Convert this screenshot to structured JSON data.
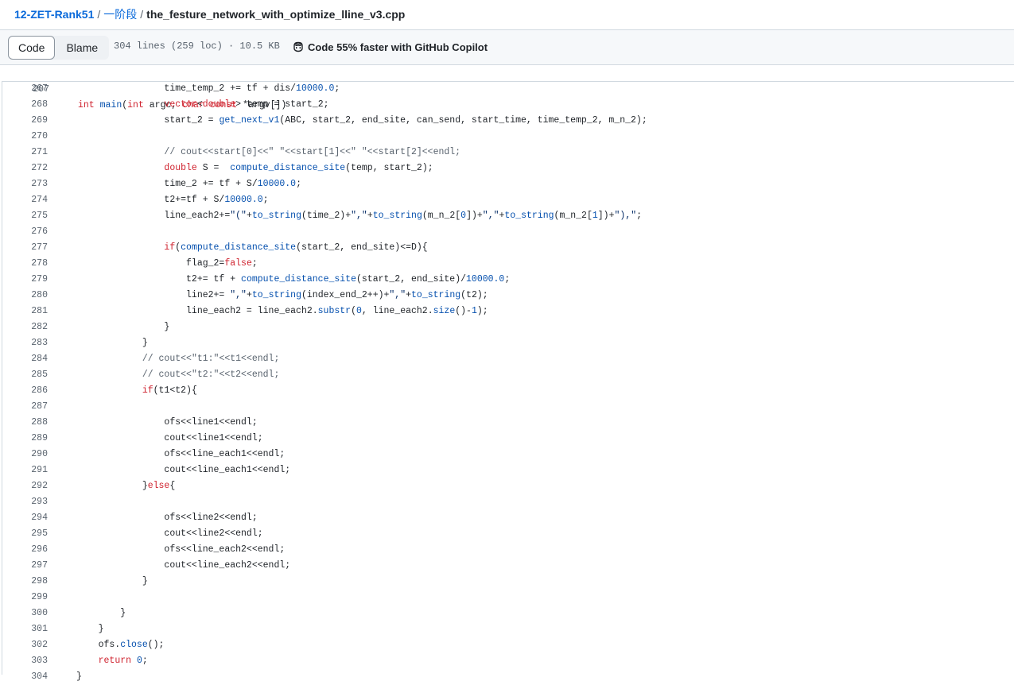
{
  "breadcrumb": {
    "repo": "12-ZET-Rank51",
    "folder": "一阶段",
    "file": "the_festure_network_with_optimize_lline_v3.cpp",
    "sep": "/"
  },
  "toolbar": {
    "code_label": "Code",
    "blame_label": "Blame",
    "meta": "304 lines (259 loc) · 10.5 KB",
    "copilot_label": "Code 55% faster with GitHub Copilot"
  },
  "sticky": {
    "number": "207",
    "text": "int main(int argc, char const *argv[])"
  },
  "lines": [
    {
      "n": "267",
      "t": "                time_temp_2 += tf + dis/10000.0;"
    },
    {
      "n": "268",
      "t": "                vector<double> temp = start_2;"
    },
    {
      "n": "269",
      "t": "                start_2 = get_next_v1(ABC, start_2, end_site, can_send, start_time, time_temp_2, m_n_2);"
    },
    {
      "n": "270",
      "t": ""
    },
    {
      "n": "271",
      "t": "                // cout<<start[0]<<\" \"<<start[1]<<\" \"<<start[2]<<endl;"
    },
    {
      "n": "272",
      "t": "                double S =  compute_distance_site(temp, start_2);"
    },
    {
      "n": "273",
      "t": "                time_2 += tf + S/10000.0;"
    },
    {
      "n": "274",
      "t": "                t2+=tf + S/10000.0;"
    },
    {
      "n": "275",
      "t": "                line_each2+=\"(\"+to_string(time_2)+\",\"+to_string(m_n_2[0])+\",\"+to_string(m_n_2[1])+\"),\";"
    },
    {
      "n": "276",
      "t": ""
    },
    {
      "n": "277",
      "t": "                if(compute_distance_site(start_2, end_site)<=D){"
    },
    {
      "n": "278",
      "t": "                    flag_2=false;"
    },
    {
      "n": "279",
      "t": "                    t2+= tf + compute_distance_site(start_2, end_site)/10000.0;"
    },
    {
      "n": "280",
      "t": "                    line2+= \",\"+to_string(index_end_2++)+\",\"+to_string(t2);"
    },
    {
      "n": "281",
      "t": "                    line_each2 = line_each2.substr(0, line_each2.size()-1);"
    },
    {
      "n": "282",
      "t": "                }"
    },
    {
      "n": "283",
      "t": "            }"
    },
    {
      "n": "284",
      "t": "            // cout<<\"t1:\"<<t1<<endl;"
    },
    {
      "n": "285",
      "t": "            // cout<<\"t2:\"<<t2<<endl;"
    },
    {
      "n": "286",
      "t": "            if(t1<t2){"
    },
    {
      "n": "287",
      "t": ""
    },
    {
      "n": "288",
      "t": "                ofs<<line1<<endl;"
    },
    {
      "n": "289",
      "t": "                cout<<line1<<endl;"
    },
    {
      "n": "290",
      "t": "                ofs<<line_each1<<endl;"
    },
    {
      "n": "291",
      "t": "                cout<<line_each1<<endl;"
    },
    {
      "n": "292",
      "t": "            }else{"
    },
    {
      "n": "293",
      "t": ""
    },
    {
      "n": "294",
      "t": "                ofs<<line2<<endl;"
    },
    {
      "n": "295",
      "t": "                cout<<line2<<endl;"
    },
    {
      "n": "296",
      "t": "                ofs<<line_each2<<endl;"
    },
    {
      "n": "297",
      "t": "                cout<<line_each2<<endl;"
    },
    {
      "n": "298",
      "t": "            }"
    },
    {
      "n": "299",
      "t": ""
    },
    {
      "n": "300",
      "t": "        }"
    },
    {
      "n": "301",
      "t": "    }"
    },
    {
      "n": "302",
      "t": "    ofs.close();"
    },
    {
      "n": "303",
      "t": "    return 0;"
    },
    {
      "n": "304",
      "t": "}"
    }
  ],
  "colors": {
    "link": "#0969da",
    "keyword": "#cf222e",
    "function": "#0550ae",
    "string": "#0a3069",
    "comment": "#59636e"
  },
  "icons": {
    "copilot": "copilot-icon"
  }
}
